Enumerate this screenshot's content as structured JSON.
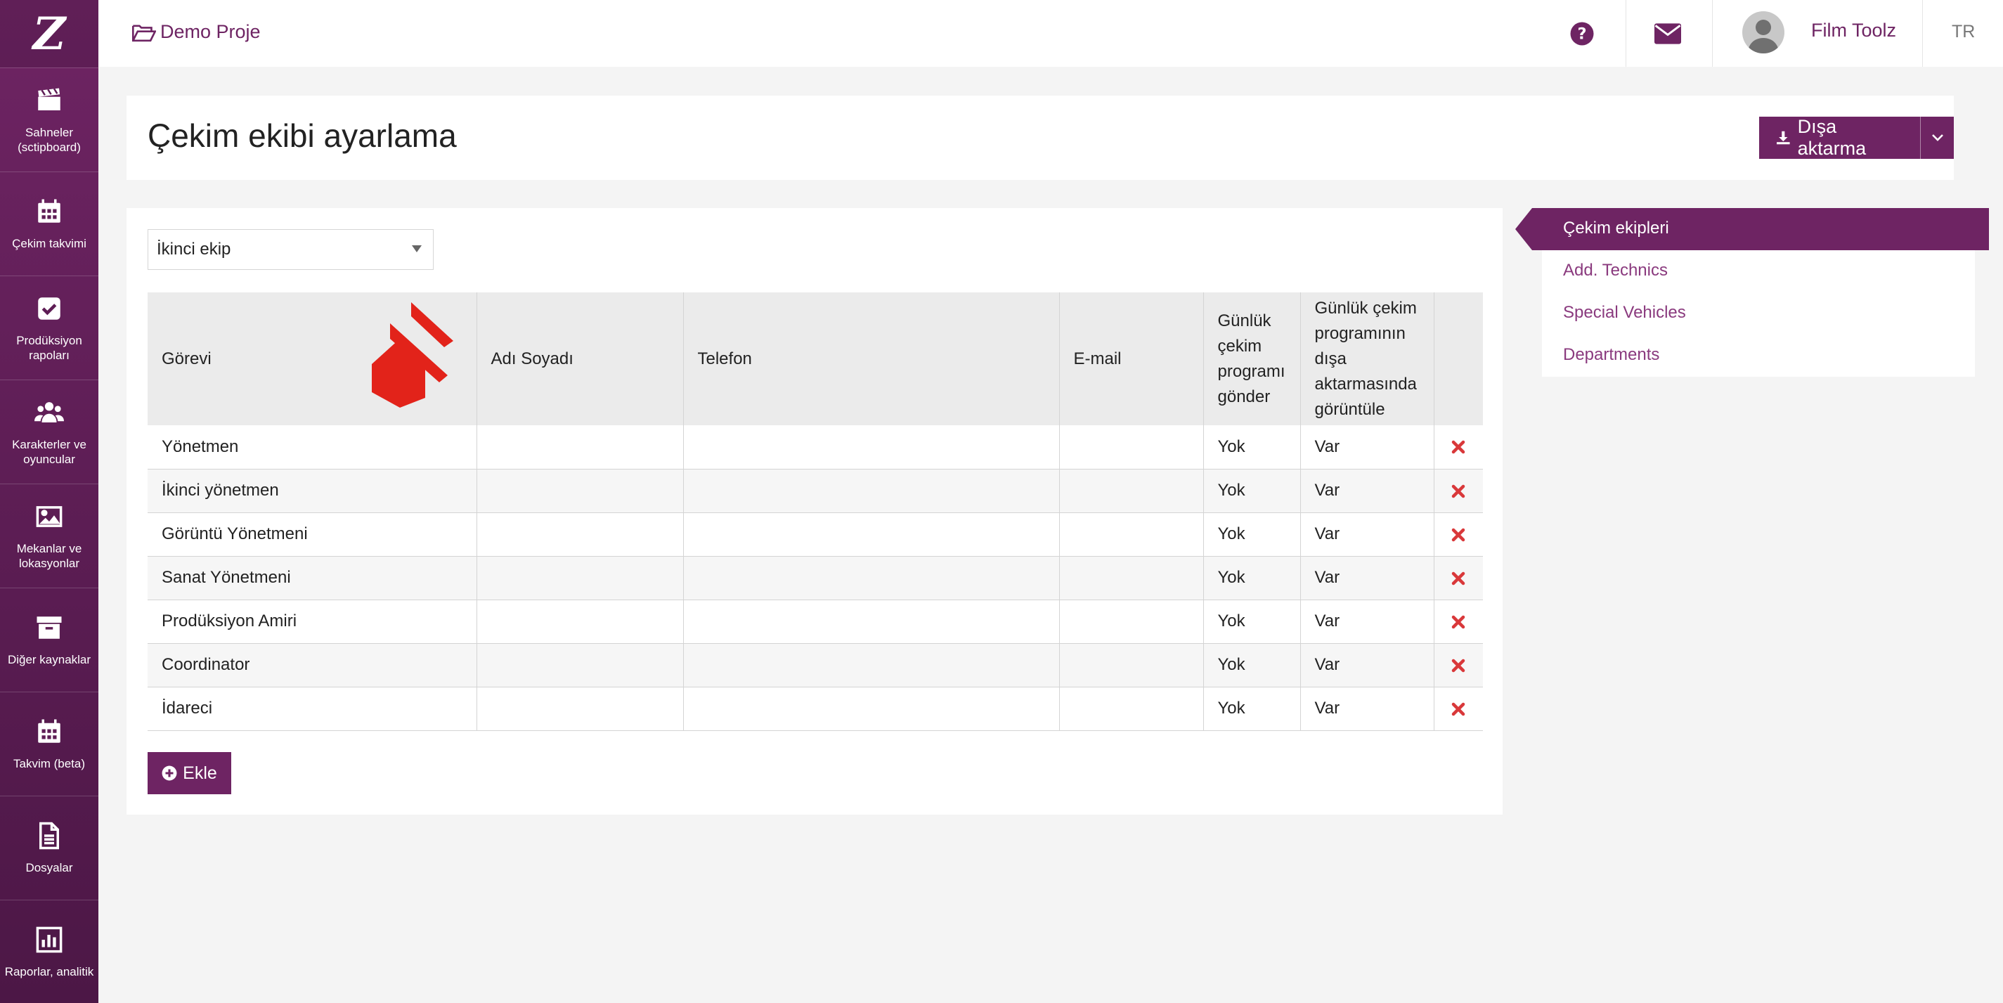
{
  "app": {
    "logo_text": "Z",
    "brand_color": "#6e2463",
    "delete_color": "#d9383a"
  },
  "sidebar": {
    "items": [
      {
        "label": "Sahneler (sctipboard)",
        "icon": "clapperboard-icon"
      },
      {
        "label": "Çekim takvimi",
        "icon": "calendar-icon"
      },
      {
        "label": "Prodüksiyon rapoları",
        "icon": "check-square-icon"
      },
      {
        "label": "Karakterler ve oyuncular",
        "icon": "users-icon"
      },
      {
        "label": "Mekanlar ve lokasyonlar",
        "icon": "image-icon"
      },
      {
        "label": "Diğer kaynaklar",
        "icon": "archive-box-icon"
      },
      {
        "label": "Takvim (beta)",
        "icon": "calendar-icon"
      },
      {
        "label": "Dosyalar",
        "icon": "file-icon"
      },
      {
        "label": "Raporlar, analitik",
        "icon": "bar-chart-icon"
      }
    ]
  },
  "topbar": {
    "project": "Demo Proje",
    "user": "Film Toolz",
    "lang": "TR"
  },
  "header": {
    "title": "Çekim ekibi ayarlama",
    "export_label": "Dışa aktarma"
  },
  "crew_select": {
    "value": "İkinci ekip"
  },
  "table": {
    "headers": [
      "Görevi",
      "Adı Soyadı",
      "Telefon",
      "E-mail",
      "Günlük çekim programı gönder",
      "Günlük çekim programının dışa aktarmasında görüntüle"
    ],
    "rows": [
      {
        "role": "Yönetmen",
        "name": "",
        "phone": "",
        "email": "",
        "send": "Yok",
        "show": "Var"
      },
      {
        "role": "İkinci yönetmen",
        "name": "",
        "phone": "",
        "email": "",
        "send": "Yok",
        "show": "Var"
      },
      {
        "role": "Görüntü Yönetmeni",
        "name": "",
        "phone": "",
        "email": "",
        "send": "Yok",
        "show": "Var"
      },
      {
        "role": "Sanat Yönetmeni",
        "name": "",
        "phone": "",
        "email": "",
        "send": "Yok",
        "show": "Var"
      },
      {
        "role": "Prodüksiyon Amiri",
        "name": "",
        "phone": "",
        "email": "",
        "send": "Yok",
        "show": "Var"
      },
      {
        "role": "Coordinator",
        "name": "",
        "phone": "",
        "email": "",
        "send": "Yok",
        "show": "Var"
      },
      {
        "role": "İdareci",
        "name": "",
        "phone": "",
        "email": "",
        "send": "Yok",
        "show": "Var"
      }
    ]
  },
  "add_button": {
    "label": "Ekle"
  },
  "right_menu": {
    "items": [
      {
        "label": "Çekim ekipleri",
        "active": true
      },
      {
        "label": "Add. Technics",
        "active": false
      },
      {
        "label": "Special Vehicles",
        "active": false
      },
      {
        "label": "Departments",
        "active": false
      }
    ]
  }
}
